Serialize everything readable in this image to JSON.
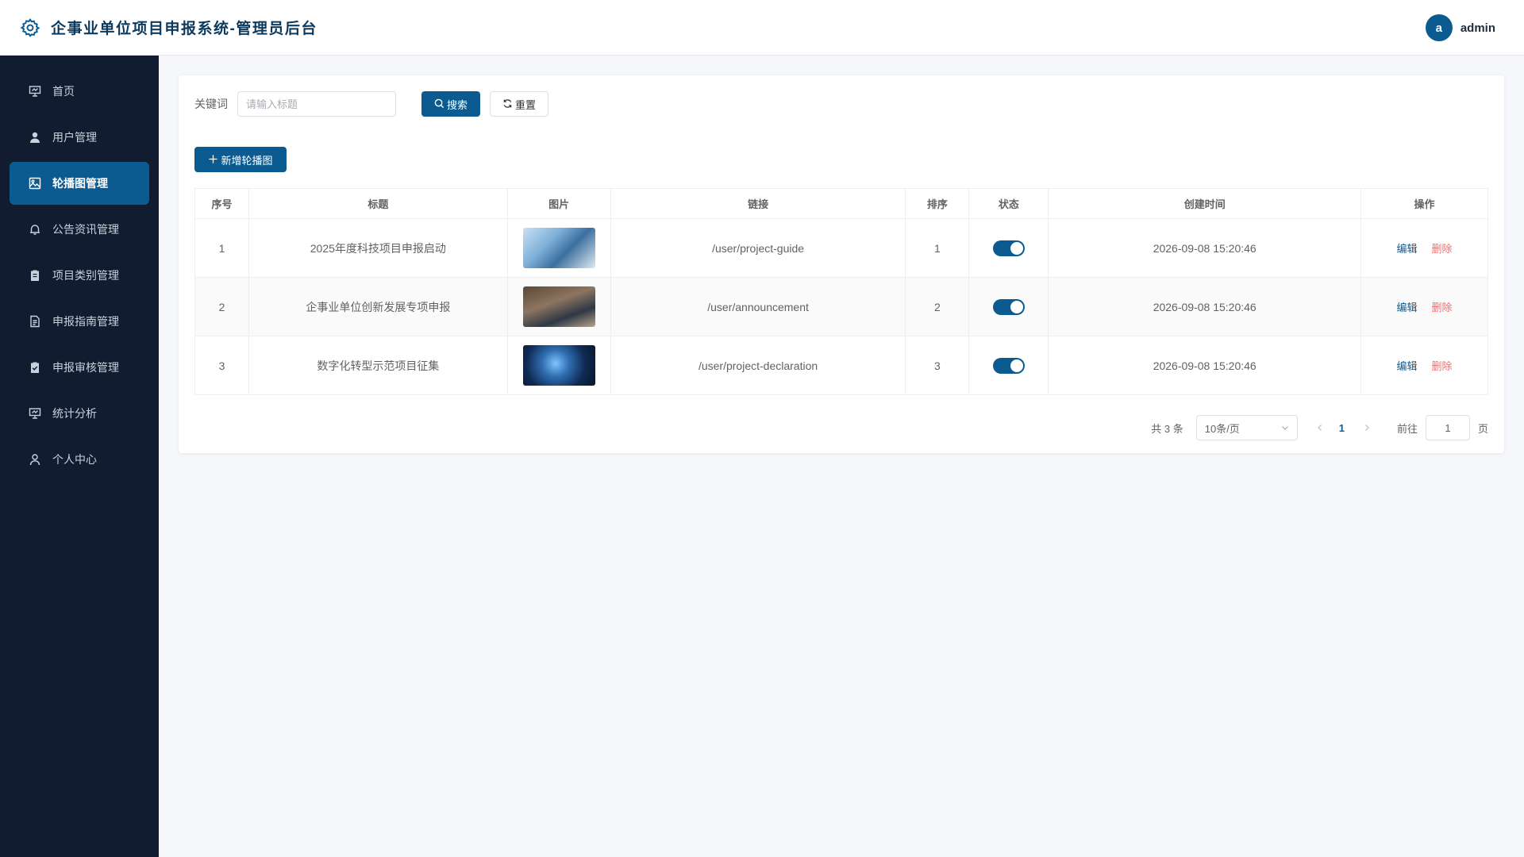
{
  "header": {
    "app_title": "企事业单位项目申报系统-管理员后台",
    "avatar_letter": "a",
    "username": "admin"
  },
  "sidebar": {
    "items": [
      {
        "label": "首页",
        "icon": "presentation-board-icon"
      },
      {
        "label": "用户管理",
        "icon": "user-icon"
      },
      {
        "label": "轮播图管理",
        "icon": "image-icon",
        "active": true
      },
      {
        "label": "公告资讯管理",
        "icon": "bell-icon"
      },
      {
        "label": "项目类别管理",
        "icon": "clipboard-icon"
      },
      {
        "label": "申报指南管理",
        "icon": "document-icon"
      },
      {
        "label": "申报审核管理",
        "icon": "clipboard-check-icon"
      },
      {
        "label": "统计分析",
        "icon": "presentation-board-icon"
      },
      {
        "label": "个人中心",
        "icon": "user-outline-icon"
      }
    ]
  },
  "search": {
    "keyword_label": "关键词",
    "placeholder": "请输入标题",
    "value": "",
    "search_label": "搜索",
    "reset_label": "重置"
  },
  "toolbar": {
    "add_label": "新增轮播图"
  },
  "table": {
    "columns": [
      "序号",
      "标题",
      "图片",
      "链接",
      "排序",
      "状态",
      "创建时间",
      "操作"
    ],
    "rows": [
      {
        "index": "1",
        "title": "2025年度科技项目申报启动",
        "link": "/user/project-guide",
        "sort": "1",
        "status": true,
        "created": "2026-09-08 15:20:46",
        "edit": "编辑",
        "delete": "删除"
      },
      {
        "index": "2",
        "title": "企事业单位创新发展专项申报",
        "link": "/user/announcement",
        "sort": "2",
        "status": true,
        "created": "2026-09-08 15:20:46",
        "edit": "编辑",
        "delete": "删除"
      },
      {
        "index": "3",
        "title": "数字化转型示范项目征集",
        "link": "/user/project-declaration",
        "sort": "3",
        "status": true,
        "created": "2026-09-08 15:20:46",
        "edit": "编辑",
        "delete": "删除"
      }
    ]
  },
  "pagination": {
    "total_text": "共 3 条",
    "page_size": "10条/页",
    "current_page": "1",
    "goto_label": "前往",
    "goto_value": "1",
    "page_suffix": "页"
  },
  "colors": {
    "primary": "#0b5b91",
    "sidebar_bg": "#111c30",
    "danger": "#f56c6c"
  }
}
